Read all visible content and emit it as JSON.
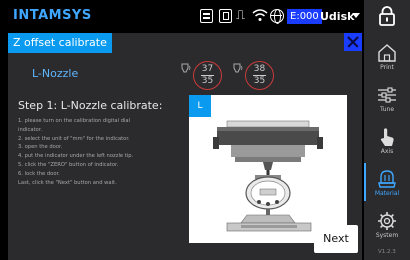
{
  "app": {
    "brand": "INTAMSYS"
  },
  "status_bar": {
    "icons": [
      "list-icon",
      "usb-icon",
      "lan-icon",
      "wifi-icon",
      "globe-icon",
      "more-icon"
    ],
    "error_badge": "E:000",
    "storage_label": "Udisk"
  },
  "page": {
    "title": "Z offset calibrate",
    "nozzle": "L-Nozzle",
    "temps": {
      "left": {
        "current": "37",
        "target": "35"
      },
      "right": {
        "current": "38",
        "target": "35"
      }
    },
    "step_title": "Step 1: L-Nozzle calibrate:",
    "instructions": [
      "1. please turn on the calibration digital dial",
      "indicator.",
      "2. select the unit of \"mm\" for the indicator.",
      "3. open the door.",
      "4. put the indicator under the left nozzle tip.",
      "5. click the \"ZERO\" button of indicator.",
      "6. lock the door.",
      "Last, click the \"Next\" button and wait."
    ],
    "illustration_tag": "L",
    "next_label": "Next"
  },
  "sidebar": {
    "items": [
      {
        "label": "Print",
        "icon": "home-icon"
      },
      {
        "label": "Tune",
        "icon": "sliders-icon"
      },
      {
        "label": "Axis",
        "icon": "hand-icon"
      },
      {
        "label": "Material",
        "icon": "material-icon",
        "active": true
      },
      {
        "label": "System",
        "icon": "gear-icon"
      }
    ],
    "version": "V1.2.3"
  },
  "colors": {
    "accent": "#0a9bf0",
    "brand": "#3fa7ff",
    "temp_ring": "#c83a3a",
    "badge": "#1a3cff"
  }
}
